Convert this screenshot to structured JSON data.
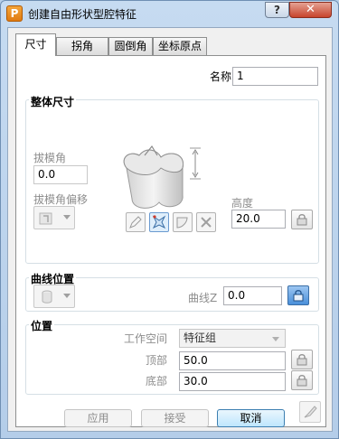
{
  "window": {
    "title": "创建自由形状型腔特征",
    "app_icon_letter": "P",
    "help_label": "?",
    "close_label": "✕"
  },
  "tabs": [
    {
      "label": "尺寸",
      "active": true
    },
    {
      "label": "拐角",
      "active": false
    },
    {
      "label": "圆倒角",
      "active": false
    },
    {
      "label": "坐标原点",
      "active": false
    }
  ],
  "name": {
    "label": "名称",
    "value": "1"
  },
  "overall": {
    "title": "整体尺寸",
    "draft_angle_label": "拔模角",
    "draft_angle_value": "0.0",
    "draft_offset_label": "拔模角偏移",
    "height_label": "高度",
    "height_value": "20.0"
  },
  "curve": {
    "title": "曲线位置",
    "curve_z_label": "曲线Z",
    "curve_z_value": "0.0"
  },
  "position": {
    "title": "位置",
    "workspace_label": "工作空间",
    "workspace_value": "特征组",
    "top_label": "顶部",
    "top_value": "50.0",
    "bottom_label": "底部",
    "bottom_value": "30.0"
  },
  "buttons": {
    "apply": "应用",
    "accept": "接受",
    "cancel": "取消"
  }
}
